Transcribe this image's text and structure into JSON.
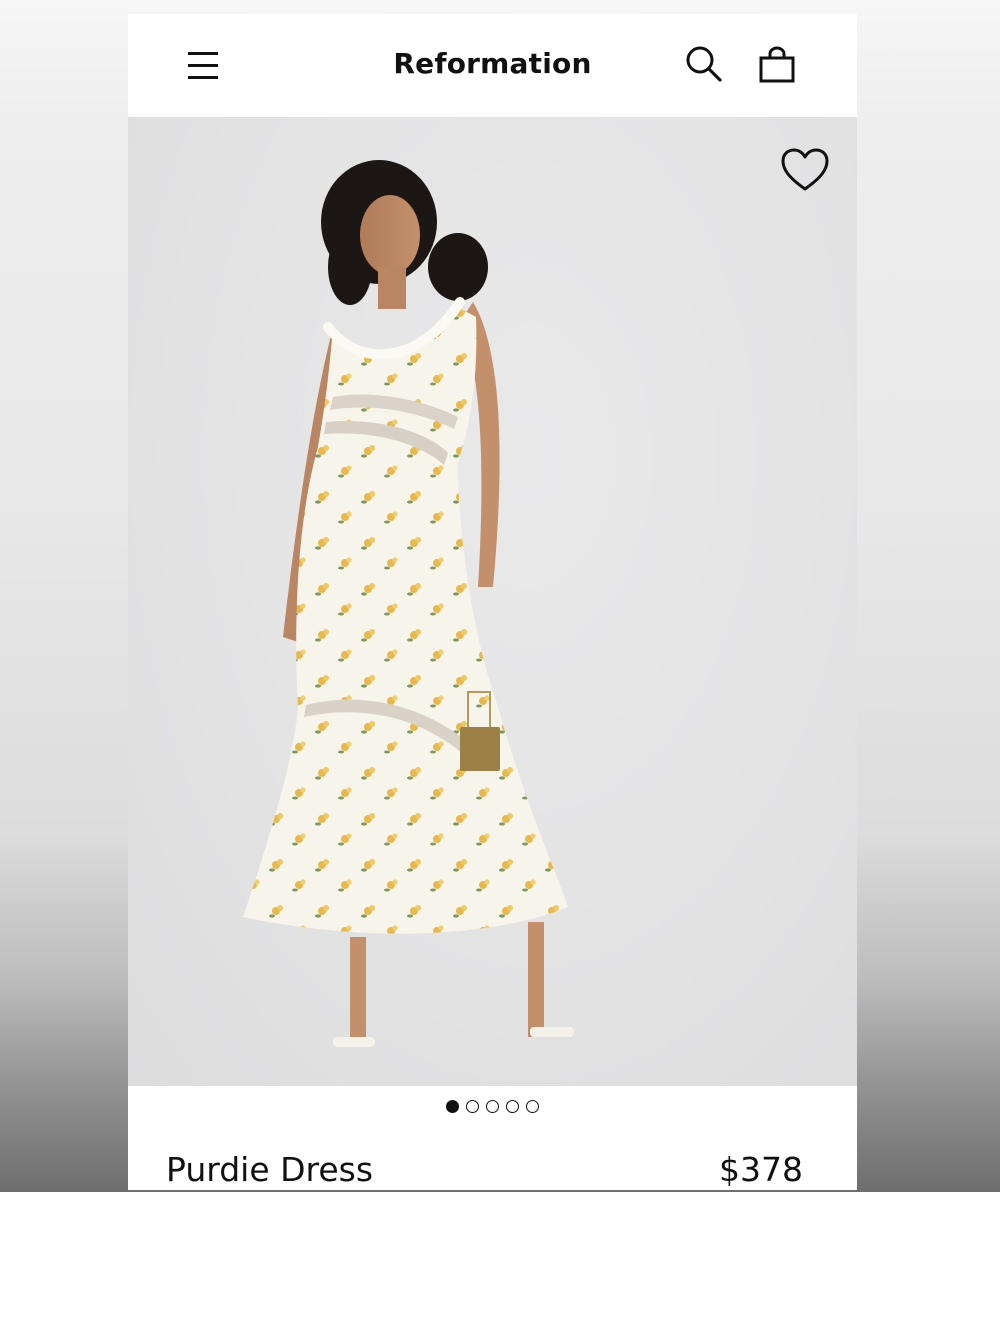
{
  "header": {
    "brand": "Reformation",
    "menu_icon": "hamburger-menu-icon",
    "search_icon": "search-icon",
    "bag_icon": "shopping-bag-icon"
  },
  "product": {
    "image": {
      "description": "model wearing cream floral midi dress with lace inserts, holding gold box bag",
      "favorite_icon": "heart-outline-icon"
    },
    "carousel": {
      "total": 5,
      "active_index": 0
    },
    "name": "Purdie Dress",
    "price": "$378"
  },
  "colors": {
    "text": "#111111",
    "hero_bg": "#e4e4e5",
    "dress": "#f7f4ec",
    "floral": "#e8b84a",
    "leaf": "#7d9a5a"
  }
}
